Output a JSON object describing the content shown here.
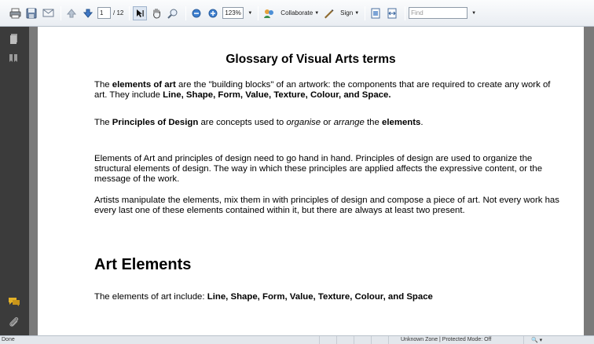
{
  "toolbar": {
    "page_current": "1",
    "page_total": "/ 12",
    "zoom": "123%",
    "collaborate_label": "Collaborate",
    "sign_label": "Sign",
    "find_placeholder": "Find"
  },
  "document": {
    "title": "Glossary of Visual Arts terms",
    "p1": [
      {
        "t": "The ",
        "b": false
      },
      {
        "t": "elements of art",
        "b": true
      },
      {
        "t": " are the \"building blocks\" of an artwork: the components that are required to create any work of art.  They include ",
        "b": false
      },
      {
        "t": "Line, Shape, Form, Value, Texture, Colour, and Space.",
        "b": true
      }
    ],
    "p2": [
      {
        "t": "The ",
        "b": false,
        "i": false
      },
      {
        "t": "Principles of Design",
        "b": true,
        "i": false
      },
      {
        "t": " are concepts used to ",
        "b": false,
        "i": false
      },
      {
        "t": "organise",
        "b": false,
        "i": true
      },
      {
        "t": " or ",
        "b": false,
        "i": false
      },
      {
        "t": "arrange",
        "b": false,
        "i": true
      },
      {
        "t": " the ",
        "b": false,
        "i": false
      },
      {
        "t": "elements",
        "b": true,
        "i": false
      },
      {
        "t": ".",
        "b": false,
        "i": false
      }
    ],
    "p3": "Elements of Art and principles of design need to go hand in hand. Principles of design are used to organize the structural elements of design. The way in which these principles are applied affects the expressive content, or the message of the work.",
    "p4": "Artists manipulate the elements, mix them in with principles of design and compose a piece of art.  Not every work has every last one of these elements contained within it, but there are always at least two present.",
    "section_heading": "Art Elements",
    "p5_prefix": "The elements of art include: ",
    "p5_bold": "Line, Shape, Form, Value, Texture, Colour, and Space"
  },
  "statusbar": {
    "left": "Done",
    "zone": "Unknown Zone | Protected Mode: Off",
    "zoom": "🔍 ▾"
  },
  "icons": [
    "printer-icon",
    "save-icon",
    "email-icon",
    "prev-page-icon",
    "next-page-icon",
    "select-tool-icon",
    "hand-tool-icon",
    "marquee-zoom-icon",
    "zoom-out-icon",
    "zoom-in-icon",
    "collaborate-icon",
    "sign-icon",
    "fit-page-icon",
    "fit-width-icon",
    "pages-icon",
    "bookmarks-icon",
    "comments-icon",
    "attachments-icon"
  ],
  "colors": {
    "nav_bg": "#3b3b3b",
    "viewport_bg": "#7a7a7a",
    "page_bg": "#ffffff"
  }
}
